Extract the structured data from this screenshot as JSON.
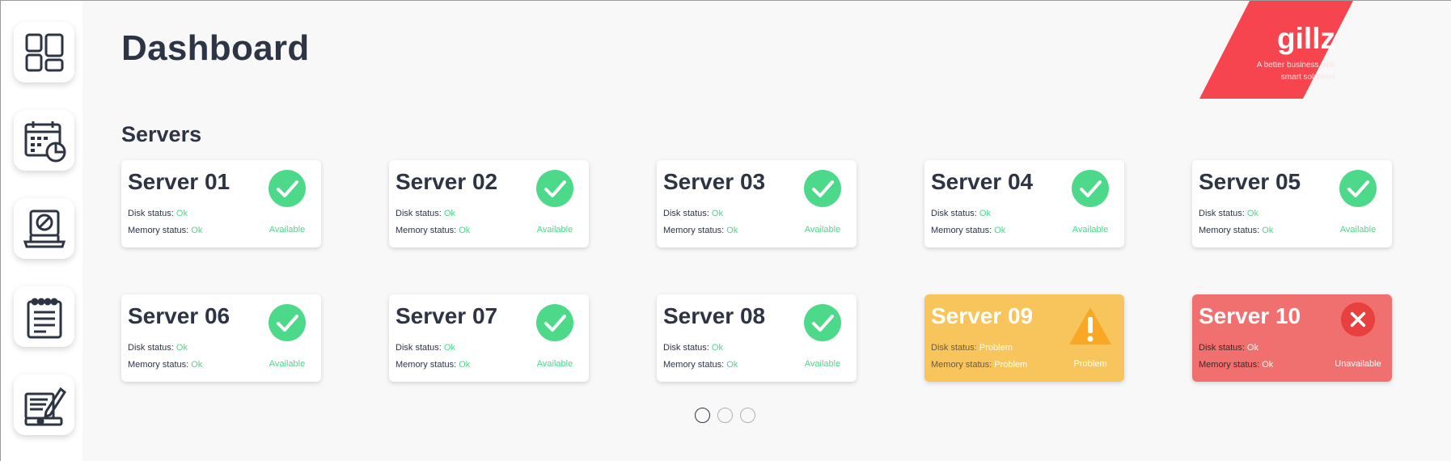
{
  "header": {
    "title": "Dashboard"
  },
  "brand": {
    "name": "gillz",
    "tagline": "A better business with smart solutions",
    "color": "#f7454f"
  },
  "section": {
    "title": "Servers"
  },
  "sidebar": {
    "items": [
      {
        "name": "dashboard-icon"
      },
      {
        "name": "calendar-chart-icon"
      },
      {
        "name": "laptop-block-icon"
      },
      {
        "name": "notepad-icon"
      },
      {
        "name": "edit-notes-icon"
      }
    ]
  },
  "labels": {
    "disk": "Disk status:",
    "memory": "Memory status:"
  },
  "colors": {
    "ok": "#4cd98a",
    "warning": "#f8c55c",
    "error": "#f07070",
    "text": "#2d3545"
  },
  "servers": [
    {
      "name": "Server 01",
      "disk": "Ok",
      "memory": "Ok",
      "state": "Available",
      "status": "ok"
    },
    {
      "name": "Server 02",
      "disk": "Ok",
      "memory": "Ok",
      "state": "Available",
      "status": "ok"
    },
    {
      "name": "Server 03",
      "disk": "Ok",
      "memory": "Ok",
      "state": "Available",
      "status": "ok"
    },
    {
      "name": "Server 04",
      "disk": "Ok",
      "memory": "Ok",
      "state": "Available",
      "status": "ok"
    },
    {
      "name": "Server 05",
      "disk": "Ok",
      "memory": "Ok",
      "state": "Available",
      "status": "ok"
    },
    {
      "name": "Server 06",
      "disk": "Ok",
      "memory": "Ok",
      "state": "Available",
      "status": "ok"
    },
    {
      "name": "Server 07",
      "disk": "Ok",
      "memory": "Ok",
      "state": "Available",
      "status": "ok"
    },
    {
      "name": "Server 08",
      "disk": "Ok",
      "memory": "Ok",
      "state": "Available",
      "status": "ok"
    },
    {
      "name": "Server 09",
      "disk": "Problem",
      "memory": "Problem",
      "state": "Problem",
      "status": "warning"
    },
    {
      "name": "Server 10",
      "disk": "Ok",
      "memory": "Ok",
      "state": "Unavailable",
      "status": "error"
    }
  ],
  "pagination": {
    "pages": 3,
    "current": 1
  }
}
